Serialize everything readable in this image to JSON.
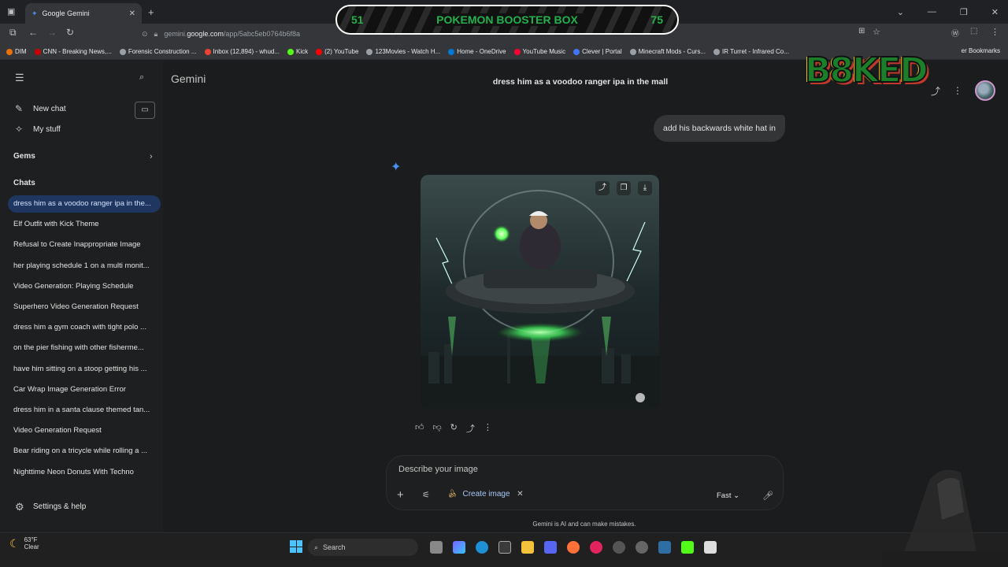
{
  "browser": {
    "tab_title": "Google Gemini",
    "tab_close": "✕",
    "new_tab": "+",
    "url_prefix": "gemini.",
    "url_domain": "google.com",
    "url_path": "/app/5abc5eb0764b6f8a",
    "bookmarks": [
      {
        "label": "DIM",
        "color": "#e8710a"
      },
      {
        "label": "CNN - Breaking News,...",
        "color": "#cc0000"
      },
      {
        "label": "Forensic Construction ...",
        "color": "#9aa0a6"
      },
      {
        "label": "Inbox (12,894) - whud...",
        "color": "#ea4335"
      },
      {
        "label": "Kick",
        "color": "#53fc18"
      },
      {
        "label": "(2) YouTube",
        "color": "#ff0000"
      },
      {
        "label": "123Movies - Watch H...",
        "color": "#9aa0a6"
      },
      {
        "label": "Home - OneDrive",
        "color": "#0078d4"
      },
      {
        "label": "YouTube Music",
        "color": "#ff0033"
      },
      {
        "label": "Clever | Portal",
        "color": "#4274f6"
      },
      {
        "label": "Minecraft Mods - Curs...",
        "color": "#9aa0a6"
      },
      {
        "label": "IR Turret - Infrared Co...",
        "color": "#9aa0a6"
      }
    ],
    "other_bookmarks": "er Bookmarks"
  },
  "overlay": {
    "left_number": "51",
    "title": "POKEMON BOOSTER BOX",
    "right_number": "75",
    "logo_text": "B8KED"
  },
  "sidebar": {
    "new_chat": "New chat",
    "my_stuff": "My stuff",
    "gems": "Gems",
    "chats_header": "Chats",
    "chats": [
      "dress him as a voodoo ranger ipa in the...",
      "Elf Outfit with Kick Theme",
      "Refusal to Create Inappropriate Image",
      "her playing schedule 1 on a multi monit...",
      "Video Generation: Playing Schedule",
      "Superhero Video Generation Request",
      "dress him a gym coach with tight polo ...",
      "on the pier fishing with other fisherme...",
      "have him sitting on a stoop getting his ...",
      "Car Wrap Image Generation Error",
      "dress him in a santa clause themed tan...",
      "Video Generation Request",
      "Bear riding on a tricycle while rolling a ...",
      "Nighttime Neon Donuts With Techno"
    ],
    "settings": "Settings & help"
  },
  "main": {
    "app_name": "Gemini",
    "conversation_title": "dress him as a voodoo ranger ipa in the mall",
    "user_message": "add his backwards white hat in",
    "input_placeholder": "Describe your image",
    "create_image_chip": "Create image",
    "mode": "Fast",
    "disclaimer": "Gemini is AI and can make mistakes."
  },
  "taskbar": {
    "temperature": "63°F",
    "condition": "Clear",
    "search": "Search"
  },
  "colors": {
    "accent_active_chat": "#1f3760",
    "sparkle": "#4b8ef1",
    "banner_text": "#22b14c"
  }
}
